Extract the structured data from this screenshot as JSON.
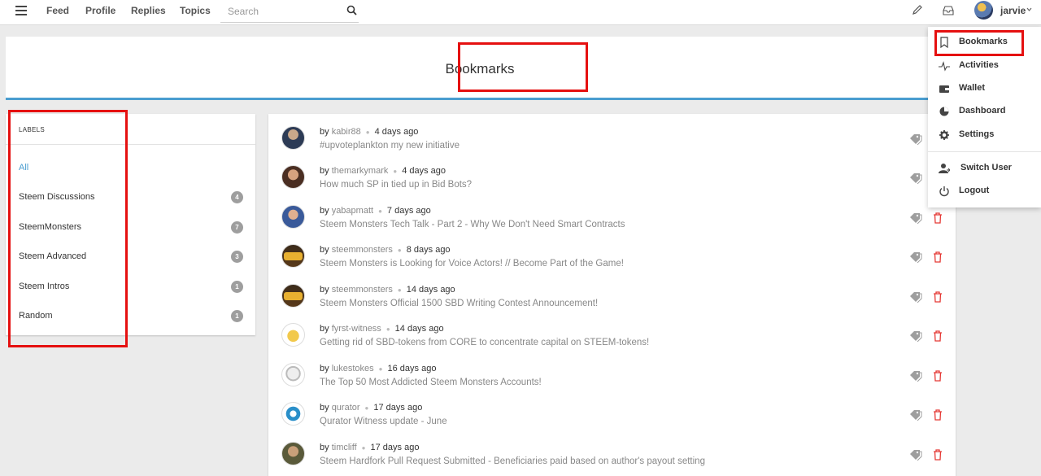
{
  "nav": {
    "links": [
      "Feed",
      "Profile",
      "Replies",
      "Topics"
    ],
    "search_placeholder": "Search",
    "username": "jarvie"
  },
  "banner": {
    "title": "Bookmarks"
  },
  "labels": {
    "heading": "LABELS",
    "items": [
      {
        "label": "All",
        "count": ""
      },
      {
        "label": "Steem Discussions",
        "count": "4"
      },
      {
        "label": "SteemMonsters",
        "count": "7"
      },
      {
        "label": "Steem Advanced",
        "count": "3"
      },
      {
        "label": "Steem Intros",
        "count": "1"
      },
      {
        "label": "Random",
        "count": "1"
      }
    ]
  },
  "bookmarks": [
    {
      "by": "by",
      "author": "kabir88",
      "age": "4 days ago",
      "title": "#upvoteplankton my new initiative"
    },
    {
      "by": "by",
      "author": "themarkymark",
      "age": "4 days ago",
      "title": "How much SP in tied up in Bid Bots?"
    },
    {
      "by": "by",
      "author": "yabapmatt",
      "age": "7 days ago",
      "title": "Steem Monsters Tech Talk - Part 2 - Why We Don't Need Smart Contracts"
    },
    {
      "by": "by",
      "author": "steemmonsters",
      "age": "8 days ago",
      "title": "Steem Monsters is Looking for Voice Actors! // Become Part of the Game!"
    },
    {
      "by": "by",
      "author": "steemmonsters",
      "age": "14 days ago",
      "title": "Steem Monsters Official 1500 SBD Writing Contest Announcement!"
    },
    {
      "by": "by",
      "author": "fyrst-witness",
      "age": "14 days ago",
      "title": "Getting rid of SBD-tokens from CORE to concentrate capital on STEEM-tokens!"
    },
    {
      "by": "by",
      "author": "lukestokes",
      "age": "16 days ago",
      "title": "The Top 50 Most Addicted Steem Monsters Accounts!"
    },
    {
      "by": "by",
      "author": "qurator",
      "age": "17 days ago",
      "title": "Qurator Witness update - June"
    },
    {
      "by": "by",
      "author": "timcliff",
      "age": "17 days ago",
      "title": "Steem Hardfork Pull Request Submitted - Beneficiaries paid based on author's payout setting"
    }
  ],
  "menu": {
    "items": [
      "Bookmarks",
      "Activities",
      "Wallet",
      "Dashboard",
      "Settings",
      "Switch User",
      "Logout"
    ]
  },
  "colors": {
    "accent": "#4a9dd0",
    "highlight": "#e51010",
    "badge": "#9e9e9e",
    "trash": "#e53935"
  }
}
